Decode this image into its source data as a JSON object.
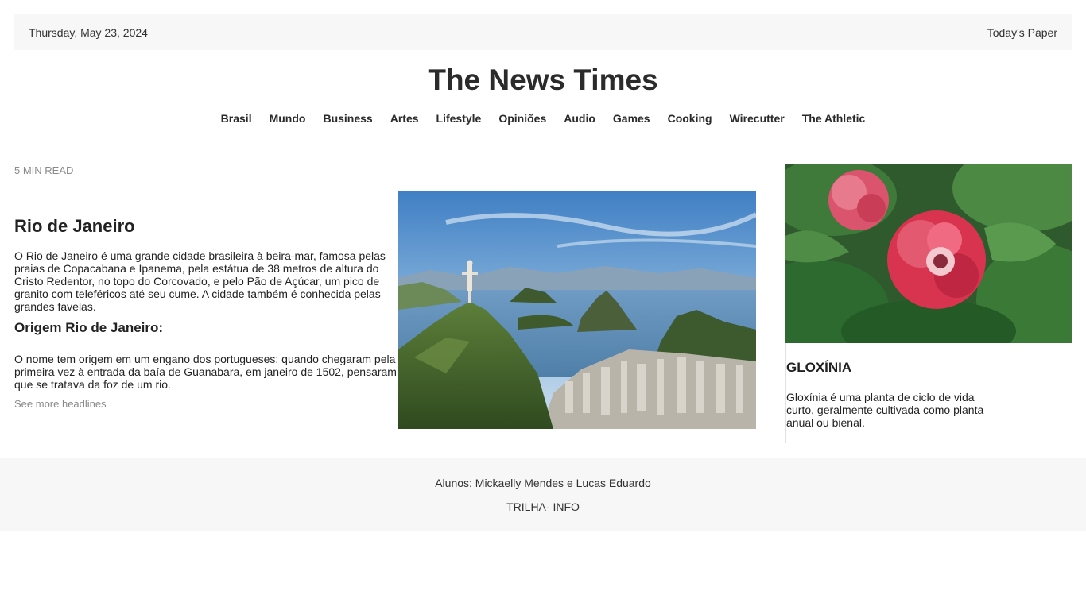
{
  "topbar": {
    "date": "Thursday, May 23, 2024",
    "todays_paper": "Today's Paper"
  },
  "masthead": {
    "title": "The News Times"
  },
  "nav": {
    "items": [
      "Brasil",
      "Mundo",
      "Business",
      "Artes",
      "Lifestyle",
      "Opiniões",
      "Audio",
      "Games",
      "Cooking",
      "Wirecutter",
      "The Athletic"
    ]
  },
  "main_article": {
    "read_time": "5 MIN READ",
    "title": "Rio de Janeiro",
    "body": "O Rio de Janeiro é uma grande cidade brasileira à beira-mar, famosa pelas praias de Copacabana e Ipanema, pela estátua de 38 metros de altura do Cristo Redentor, no topo do Corcovado, e pelo Pão de Açúcar, um pico de granito com teleféricos até seu cume. A cidade também é conhecida pelas grandes favelas.",
    "subtitle": "Origem Rio de Janeiro:",
    "origin_text": "O nome tem origem em um engano dos portugueses: quando chegaram pela primeira vez à entrada da baía de Guanabara, em janeiro de 1502, pensaram que se tratava da foz de um rio.",
    "more_link": "See more headlines"
  },
  "side_article": {
    "title": "GLOXÍNIA",
    "body": "Gloxínia é uma planta de ciclo de vida curto, geralmente cultivada como planta anual ou bienal."
  },
  "footer": {
    "students": "Alunos: Mickaelly Mendes e Lucas Eduardo",
    "track": "TRILHA- INFO"
  }
}
